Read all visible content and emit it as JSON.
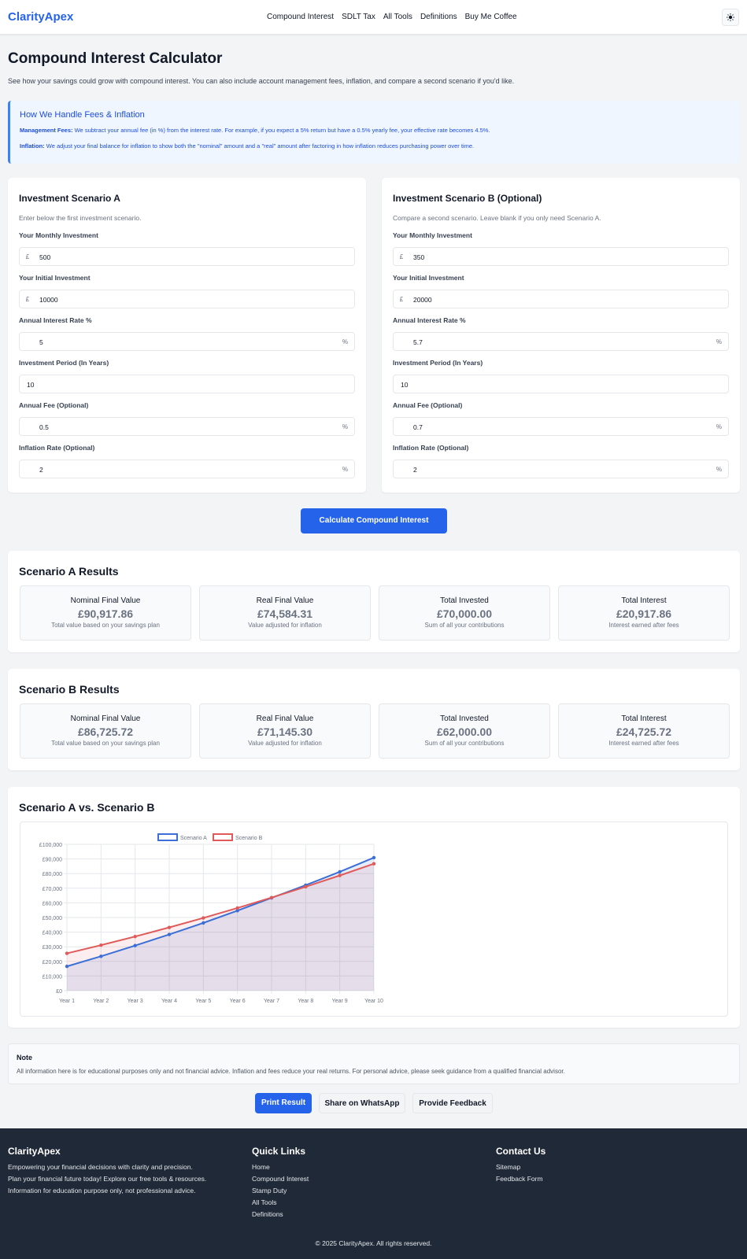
{
  "header": {
    "logo": "ClarityApex",
    "nav": [
      "Compound Interest",
      "SDLT Tax",
      "All Tools",
      "Definitions",
      "Buy Me Coffee"
    ],
    "theme_icon": "sun-icon"
  },
  "page": {
    "title": "Compound Interest Calculator",
    "intro": "See how your savings could grow with compound interest. You can also include account management fees, inflation, and compare a second scenario if you'd like."
  },
  "info": {
    "title": "How We Handle Fees & Inflation",
    "fees_label": "Management Fees:",
    "fees_text": " We subtract your annual fee (in %) from the interest rate. For example, if you expect a 5% return but have a 0.5% yearly fee, your effective rate becomes 4.5%.",
    "inflation_label": "Inflation:",
    "inflation_text": " We adjust your final balance for inflation to show both the \"nominal\" amount and a \"real\" amount after factoring in how inflation reduces purchasing power over time."
  },
  "labels": {
    "monthly": "Your Monthly Investment",
    "initial": "Your Initial Investment",
    "rate": "Annual Interest Rate %",
    "period": "Investment Period (In Years)",
    "fee": "Annual Fee (Optional)",
    "inflation": "Inflation Rate (Optional)",
    "currency": "£",
    "percent": "%"
  },
  "scenario_a": {
    "title": "Investment Scenario A",
    "subtitle": "Enter below the first investment scenario.",
    "monthly": "500",
    "initial": "10000",
    "rate": "5",
    "period": "10",
    "fee": "0.5",
    "inflation": "2"
  },
  "scenario_b": {
    "title": "Investment Scenario B (Optional)",
    "subtitle": "Compare a second scenario. Leave blank if you only need Scenario A.",
    "monthly": "350",
    "initial": "20000",
    "rate": "5.7",
    "period": "10",
    "fee": "0.7",
    "inflation": "2"
  },
  "calculate_label": "Calculate Compound Interest",
  "result_labels": {
    "nominal": "Nominal Final Value",
    "nominal_desc": "Total value based on your savings plan",
    "real": "Real Final Value",
    "real_desc": "Value adjusted for inflation",
    "invested": "Total Invested",
    "invested_desc": "Sum of all your contributions",
    "interest": "Total Interest",
    "interest_desc": "Interest earned after fees"
  },
  "results_a": {
    "title": "Scenario A Results",
    "nominal": "£90,917.86",
    "real": "£74,584.31",
    "invested": "£70,000.00",
    "interest": "£20,917.86"
  },
  "results_b": {
    "title": "Scenario B Results",
    "nominal": "£86,725.72",
    "real": "£71,145.30",
    "invested": "£62,000.00",
    "interest": "£24,725.72"
  },
  "chart_title": "Scenario A vs. Scenario B",
  "chart_data": {
    "type": "line",
    "x": [
      "Year 1",
      "Year 2",
      "Year 3",
      "Year 4",
      "Year 5",
      "Year 6",
      "Year 7",
      "Year 8",
      "Year 9",
      "Year 10"
    ],
    "yticks": [
      "£0",
      "£10,000",
      "£20,000",
      "£30,000",
      "£40,000",
      "£50,000",
      "£60,000",
      "£70,000",
      "£80,000",
      "£90,000",
      "£100,000"
    ],
    "ylim": [
      0,
      100000
    ],
    "grid": true,
    "legend": "top",
    "series": [
      {
        "name": "Scenario A",
        "color": "#3b6fd6",
        "values": [
          16600,
          23500,
          30800,
          38400,
          46300,
          54700,
          63400,
          72100,
          81200,
          90900
        ]
      },
      {
        "name": "Scenario B",
        "color": "#e05a5a",
        "values": [
          25500,
          31100,
          37000,
          43200,
          49700,
          56500,
          63600,
          71000,
          78700,
          86700
        ]
      }
    ]
  },
  "note": {
    "title": "Note",
    "text": "All information here is for educational purposes only and not financial advice. Inflation and fees reduce your real returns. For personal advice, please seek guidance from a qualified financial advisor."
  },
  "actions": {
    "print": "Print Result",
    "whatsapp": "Share on WhatsApp",
    "feedback": "Provide Feedback"
  },
  "footer": {
    "brand": "ClarityApex",
    "tagline_1": "Empowering your financial decisions with clarity and precision.",
    "tagline_2": "Plan your financial future today! Explore our free tools & resources.",
    "tagline_3": "Information for education purpose only, not professional advice.",
    "quick_title": "Quick Links",
    "quick_links": [
      "Home",
      "Compound Interest",
      "Stamp Duty",
      "All Tools",
      "Definitions"
    ],
    "contact_title": "Contact Us",
    "contact_links": [
      "Sitemap",
      "Feedback Form"
    ],
    "copyright": "© 2025 ClarityApex. All rights reserved."
  }
}
